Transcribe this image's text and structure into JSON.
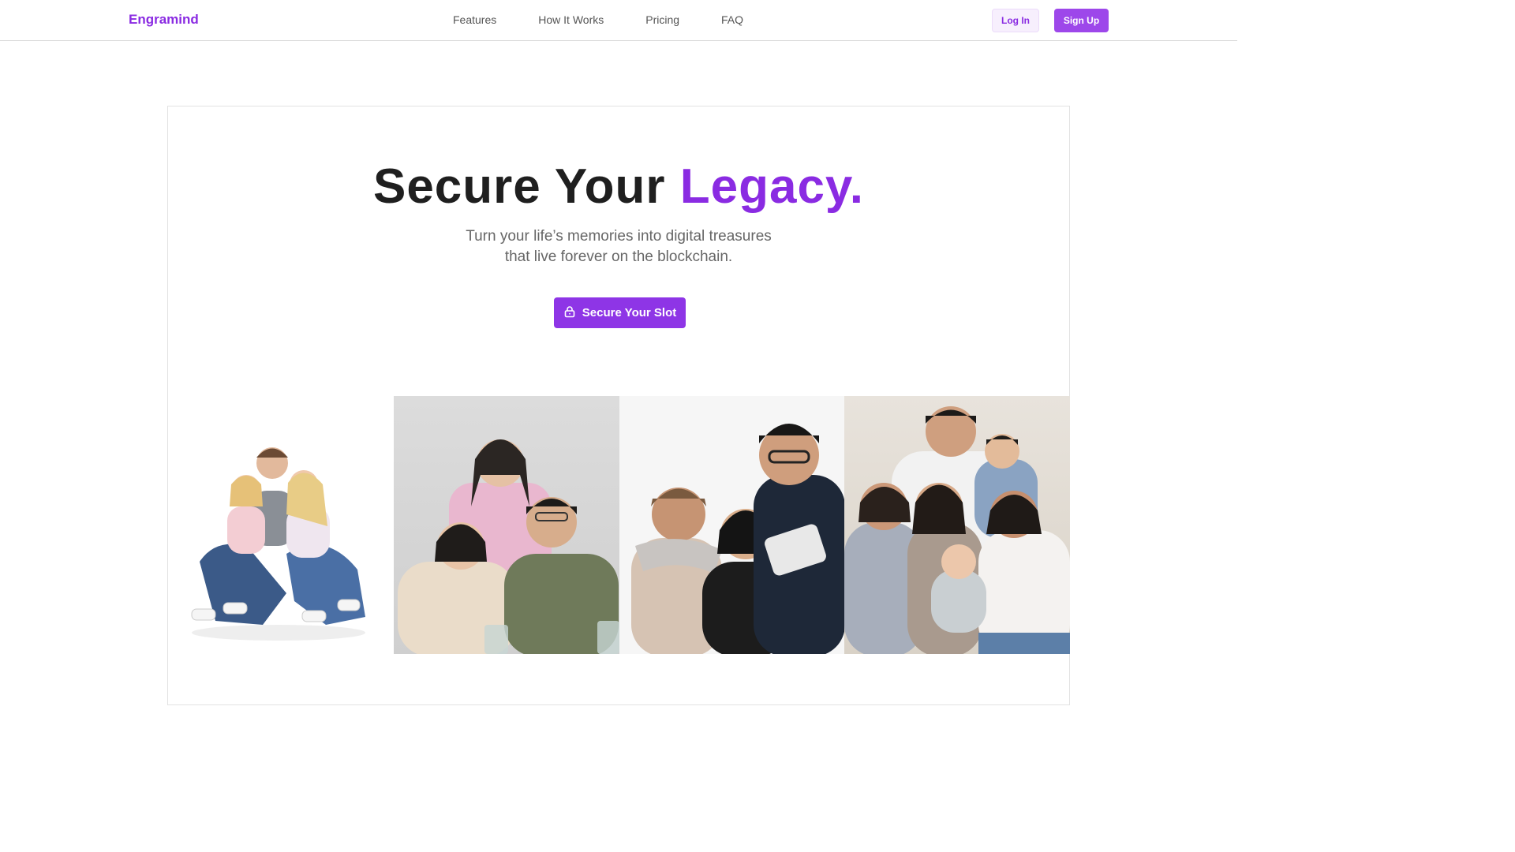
{
  "nav": {
    "brand": "Engramind",
    "links": [
      "Features",
      "How It Works",
      "Pricing",
      "FAQ"
    ],
    "login": "Log In",
    "signup": "Sign Up"
  },
  "hero": {
    "title_main": "Secure Your",
    "title_accent": "Legacy.",
    "subtitle_line1": "Turn your life’s memories into digital treasures",
    "subtitle_line2": "that live forever on the blockchain.",
    "cta_label": "Secure Your Slot",
    "cta_icon": "lock-icon"
  },
  "photos": [
    {
      "name": "family-photo-1"
    },
    {
      "name": "family-photo-2"
    },
    {
      "name": "family-photo-3"
    },
    {
      "name": "family-photo-4"
    }
  ],
  "colors": {
    "accent": "#8a2be2",
    "button": "#8e35e6",
    "text": "#1f1f1f",
    "muted": "#666666"
  }
}
